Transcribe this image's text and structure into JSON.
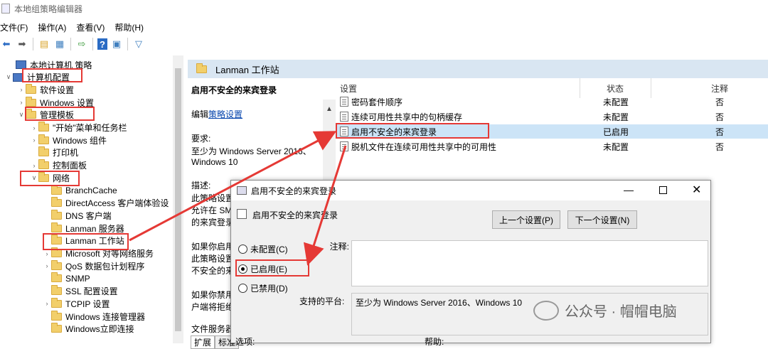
{
  "window": {
    "title": "本地组策略编辑器"
  },
  "menu": [
    "文件(F)",
    "操作(A)",
    "查看(V)",
    "帮助(H)"
  ],
  "toolbar": {
    "icons": [
      "back-icon",
      "forward-icon",
      "up-folder-icon",
      "show-tree-icon",
      "export-icon",
      "help-icon",
      "properties-icon",
      "filter-icon"
    ]
  },
  "tree": {
    "items": [
      {
        "label": "本地计算机 策略",
        "level": 0,
        "arrow": "",
        "icon": "pc"
      },
      {
        "label": "计算机配置",
        "level": 0,
        "arrow": "v",
        "icon": "pc"
      },
      {
        "label": "软件设置",
        "level": 1,
        "arrow": ">",
        "icon": "folder"
      },
      {
        "label": "Windows 设置",
        "level": 1,
        "arrow": ">",
        "icon": "folder"
      },
      {
        "label": "管理模板",
        "level": 1,
        "arrow": "v",
        "icon": "folder"
      },
      {
        "label": "\"开始\"菜单和任务栏",
        "level": 2,
        "arrow": ">",
        "icon": "folder"
      },
      {
        "label": "Windows 组件",
        "level": 2,
        "arrow": ">",
        "icon": "folder"
      },
      {
        "label": "打印机",
        "level": 2,
        "arrow": "",
        "icon": "folder"
      },
      {
        "label": "控制面板",
        "level": 2,
        "arrow": ">",
        "icon": "folder"
      },
      {
        "label": "网络",
        "level": 2,
        "arrow": "v",
        "icon": "folder"
      },
      {
        "label": "BranchCache",
        "level": 3,
        "arrow": "",
        "icon": "folder"
      },
      {
        "label": "DirectAccess 客户端体验设",
        "level": 3,
        "arrow": "",
        "icon": "folder"
      },
      {
        "label": "DNS 客户端",
        "level": 3,
        "arrow": "",
        "icon": "folder"
      },
      {
        "label": "Lanman 服务器",
        "level": 3,
        "arrow": "",
        "icon": "folder"
      },
      {
        "label": "Lanman 工作站",
        "level": 3,
        "arrow": "",
        "icon": "folder"
      },
      {
        "label": "Microsoft 对等网络服务",
        "level": 3,
        "arrow": ">",
        "icon": "folder"
      },
      {
        "label": "QoS 数据包计划程序",
        "level": 3,
        "arrow": ">",
        "icon": "folder"
      },
      {
        "label": "SNMP",
        "level": 3,
        "arrow": "",
        "icon": "folder"
      },
      {
        "label": "SSL 配置设置",
        "level": 3,
        "arrow": "",
        "icon": "folder"
      },
      {
        "label": "TCPIP 设置",
        "level": 3,
        "arrow": ">",
        "icon": "folder"
      },
      {
        "label": "Windows 连接管理器",
        "level": 3,
        "arrow": "",
        "icon": "folder"
      },
      {
        "label": "Windows立即连接",
        "level": 3,
        "arrow": "",
        "icon": "folder"
      }
    ]
  },
  "right": {
    "header": "Lanman 工作站",
    "desc": {
      "title": "启用不安全的来宾登录",
      "edit_prefix": "编辑",
      "edit_link": "策略设置",
      "req_label": "要求:",
      "req_text1": "至少为 Windows Server 2016、",
      "req_text2": "Windows 10",
      "desc_label": "描述:",
      "p1": "此策略设置",
      "p2": "允许在 SM",
      "p3": "的来宾登录",
      "p4": "如果你启用",
      "p5": "此策略设置",
      "p6": "不安全的来",
      "p7": "如果你禁用",
      "p8": "户端将拒绝",
      "p9": "文件服务器"
    },
    "tabs": [
      "扩展",
      "标准"
    ],
    "columns": {
      "setting": "设置",
      "state": "状态",
      "comment": "注释"
    },
    "rows": [
      {
        "name": "密码套件顺序",
        "state": "未配置",
        "comment": "否"
      },
      {
        "name": "连续可用性共享中的句柄缓存",
        "state": "未配置",
        "comment": "否"
      },
      {
        "name": "启用不安全的来宾登录",
        "state": "已启用",
        "comment": "否"
      },
      {
        "name": "脱机文件在连续可用性共享中的可用性",
        "state": "未配置",
        "comment": "否"
      }
    ]
  },
  "dialog": {
    "title": "启用不安全的来宾登录",
    "subtitle": "启用不安全的来宾登录",
    "prev_button": "上一个设置(P)",
    "next_button": "下一个设置(N)",
    "radio_unconfigured": "未配置(C)",
    "radio_enabled": "已启用(E)",
    "radio_disabled": "已禁用(D)",
    "comment_label": "注释:",
    "platform_label": "支持的平台:",
    "platform_value": "至少为 Windows Server 2016、Windows 10",
    "options_label": "选项:",
    "help_label": "帮助:",
    "selected": "enabled"
  },
  "watermark": {
    "text": "公众号 · 帽帽电脑"
  },
  "annotation_color": "#e53935"
}
